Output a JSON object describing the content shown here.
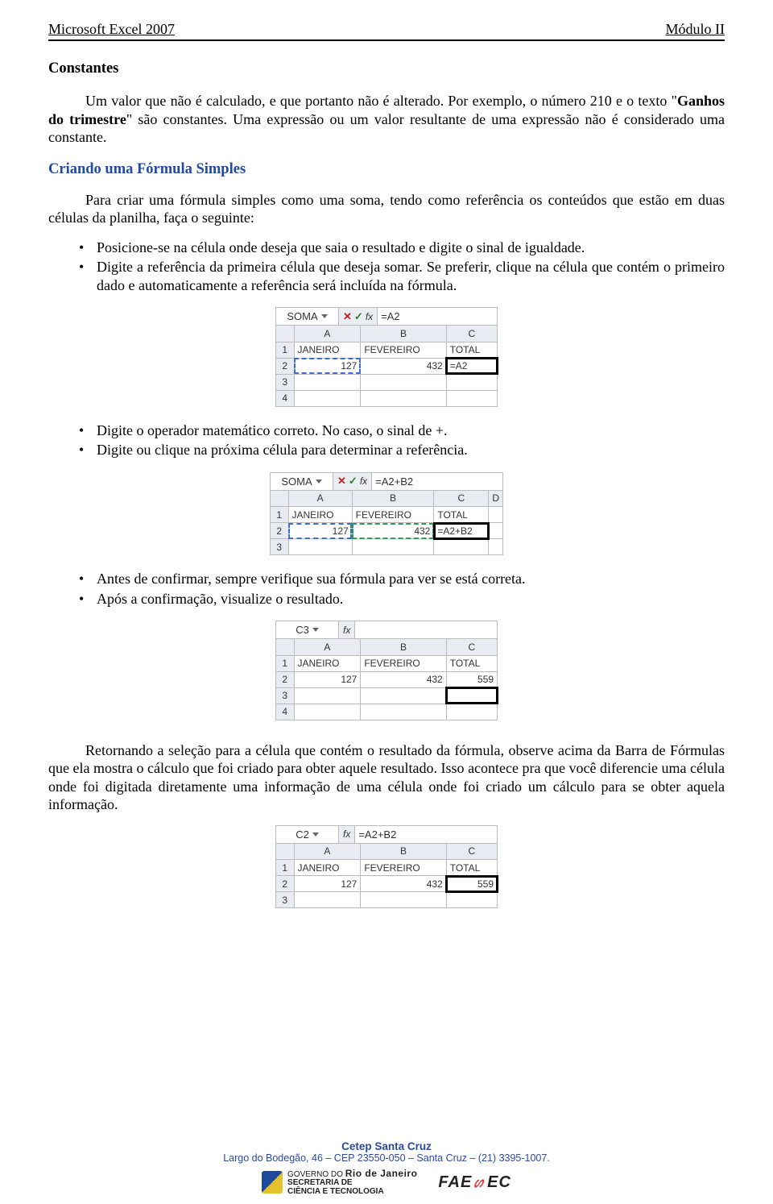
{
  "header": {
    "left": "Microsoft Excel 2007",
    "right": "Módulo II"
  },
  "section1": {
    "title": "Constantes",
    "p1_a": "Um valor que não é calculado, e que portanto não é alterado. Por exemplo, o número 210 e o texto \"",
    "p1_bold": "Ganhos do trimestre",
    "p1_b": "\" são constantes. Uma expressão ou um valor resultante de uma expressão não é considerado uma constante."
  },
  "section2": {
    "title": "Criando uma Fórmula Simples",
    "p1": "Para criar uma fórmula simples como uma soma, tendo como referência os conteúdos que estão em duas células da planilha, faça o seguinte:",
    "bullets1": [
      "Posicione-se na célula onde deseja que saia o resultado e digite o sinal de igualdade.",
      "Digite a referência da primeira célula que deseja somar. Se preferir, clique na célula que contém o primeiro dado e automaticamente a referência será incluída na fórmula."
    ],
    "bullets2": [
      "Digite o operador matemático correto. No caso, o sinal de +.",
      "Digite ou clique na próxima célula para determinar a referência."
    ],
    "bullets3": [
      "Antes de confirmar, sempre verifique sua fórmula para ver se está correta.",
      "Após a confirmação, visualize o resultado."
    ],
    "p2": "Retornando a seleção para a célula que contém o resultado da fórmula, observe acima da Barra de Fórmulas que ela mostra o cálculo que foi criado para obter aquele resultado. Isso acontece pra que você diferencie uma célula onde foi digitada diretamente uma informação de uma célula onde foi criado um cálculo para se obter aquela informação."
  },
  "figs": {
    "fig1": {
      "namebox": "SOMA",
      "fx": "fx",
      "x": "✕",
      "ck": "✓",
      "formula": "=A2",
      "cols": [
        "A",
        "B",
        "C"
      ],
      "rowhdrs": [
        "1",
        "2",
        "3",
        "4"
      ],
      "row1": [
        "JANEIRO",
        "FEVEREIRO",
        "TOTAL"
      ],
      "row2": [
        "127",
        "432",
        "=A2"
      ]
    },
    "fig2": {
      "namebox": "SOMA",
      "fx": "fx",
      "x": "✕",
      "ck": "✓",
      "formula": "=A2+B2",
      "cols": [
        "A",
        "B",
        "C",
        "D"
      ],
      "rowhdrs": [
        "1",
        "2",
        "3"
      ],
      "row1": [
        "JANEIRO",
        "FEVEREIRO",
        "TOTAL",
        ""
      ],
      "row2": [
        "127",
        "432",
        "=A2+B2",
        ""
      ]
    },
    "fig3": {
      "namebox": "C3",
      "fx": "fx",
      "formula": "",
      "cols": [
        "A",
        "B",
        "C"
      ],
      "rowhdrs": [
        "1",
        "2",
        "3",
        "4"
      ],
      "row1": [
        "JANEIRO",
        "FEVEREIRO",
        "TOTAL"
      ],
      "row2": [
        "127",
        "432",
        "559"
      ]
    },
    "fig4": {
      "namebox": "C2",
      "fx": "fx",
      "formula": "=A2+B2",
      "cols": [
        "A",
        "B",
        "C"
      ],
      "rowhdrs": [
        "1",
        "2",
        "3"
      ],
      "row1": [
        "JANEIRO",
        "FEVEREIRO",
        "TOTAL"
      ],
      "row2": [
        "127",
        "432",
        "559"
      ]
    }
  },
  "footer": {
    "line1": "Cetep Santa Cruz",
    "line2": "Largo do Bodegão, 46 – CEP 23550-050 – Santa Cruz – (21) 3395-1007.",
    "rj_small1": "GOVERNO DO",
    "rj_small2": "Rio de Janeiro",
    "rj_line2a": "SECRETARIA DE",
    "rj_line2b": "CIÊNCIA E TECNOLOGIA",
    "faetec": "FAE",
    "faetec2": "EC"
  }
}
